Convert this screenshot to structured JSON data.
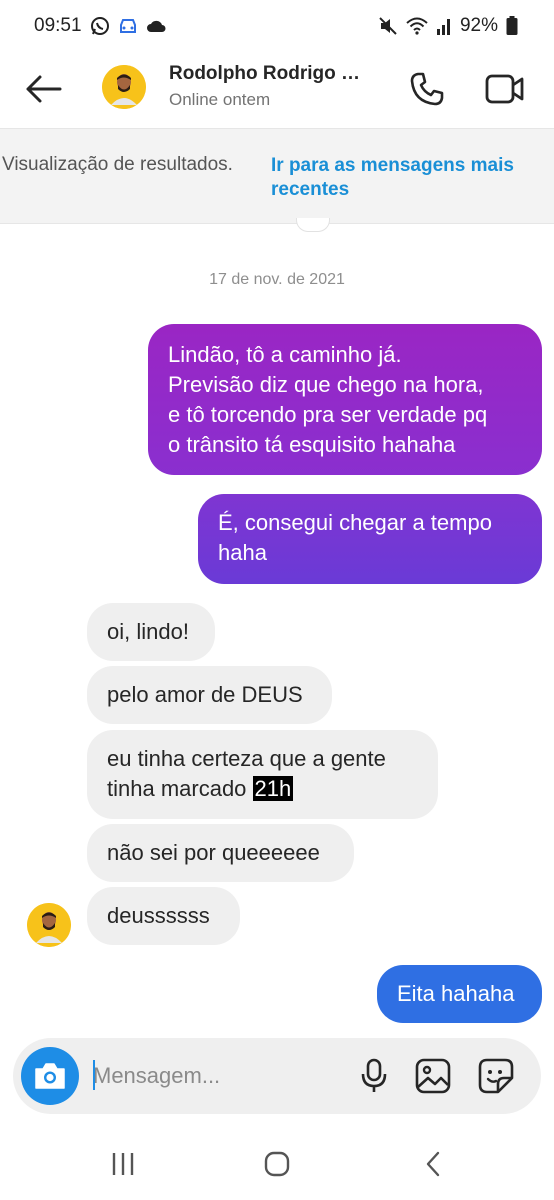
{
  "status_bar": {
    "time": "09:51",
    "battery": "92%",
    "icons": [
      "whatsapp-icon",
      "car-icon",
      "cloud-icon",
      "mute-icon",
      "wifi-icon",
      "signal-icon",
      "battery-icon"
    ]
  },
  "header": {
    "contact_name": "Rodolpho Rodrigo …",
    "contact_status": "Online ontem",
    "icons": [
      "back-arrow-icon",
      "phone-icon",
      "video-camera-icon"
    ]
  },
  "banner": {
    "text": "Visualização de resultados.",
    "link": "Ir para as mensagens mais recentes"
  },
  "conversation": {
    "date": "17 de nov. de 2021",
    "outgoing_1": {
      "line1": "Lindão, tô a caminho já.",
      "line2": "Previsão diz que chego na hora,",
      "line3": "e tô torcendo pra ser verdade pq",
      "line4": "o trânsito tá esquisito hahaha"
    },
    "outgoing_2": {
      "line1": "É, consegui chegar a tempo",
      "line2": "haha"
    },
    "incoming_1": "oi, lindo!",
    "incoming_2": "pelo amor de DEUS",
    "incoming_3": {
      "line1": "eu tinha certeza que a gente",
      "line2_prefix": "tinha marcado ",
      "line2_highlight": "21h"
    },
    "incoming_4": "não sei por queeeeee",
    "incoming_5": "deussssss",
    "outgoing_3": "Eita hahaha"
  },
  "composer": {
    "placeholder": "Mensagem...",
    "icons": [
      "camera-icon",
      "microphone-icon",
      "gallery-icon",
      "sticker-icon"
    ]
  },
  "nav_bar": {
    "icons": [
      "recents-icon",
      "home-icon",
      "back-icon"
    ]
  },
  "colors": {
    "accent_blue": "#1e8de6",
    "link_blue": "#1a8fd6",
    "bubble_purple": "#9a26c4",
    "bubble_violet": "#7037d4",
    "bubble_blue": "#2f6fe3",
    "incoming_gray": "#efefef"
  }
}
